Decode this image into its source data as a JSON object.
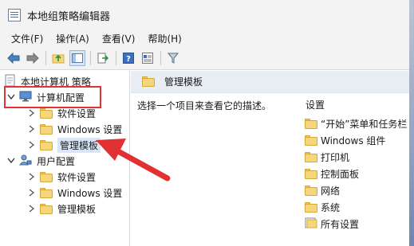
{
  "window": {
    "title": "本地组策略编辑器"
  },
  "menubar": {
    "items": [
      "文件(F)",
      "操作(A)",
      "查看(V)",
      "帮助(H)"
    ]
  },
  "tree": {
    "root": "本地计算机 策略",
    "computer": {
      "label": "计算机配置",
      "children": [
        "软件设置",
        "Windows 设置",
        "管理模板"
      ]
    },
    "user": {
      "label": "用户配置",
      "children": [
        "软件设置",
        "Windows 设置",
        "管理模板"
      ]
    }
  },
  "right": {
    "header": "管理模板",
    "description": "选择一个项目来查看它的描述。",
    "column_header": "设置",
    "items": [
      "“开始”菜单和任务栏",
      "Windows 组件",
      "打印机",
      "控制面板",
      "网络",
      "系统",
      "所有设置"
    ]
  },
  "colors": {
    "annotation": "#e03232",
    "folder": "#f6d67a",
    "header_bg": "#e9eef5"
  }
}
